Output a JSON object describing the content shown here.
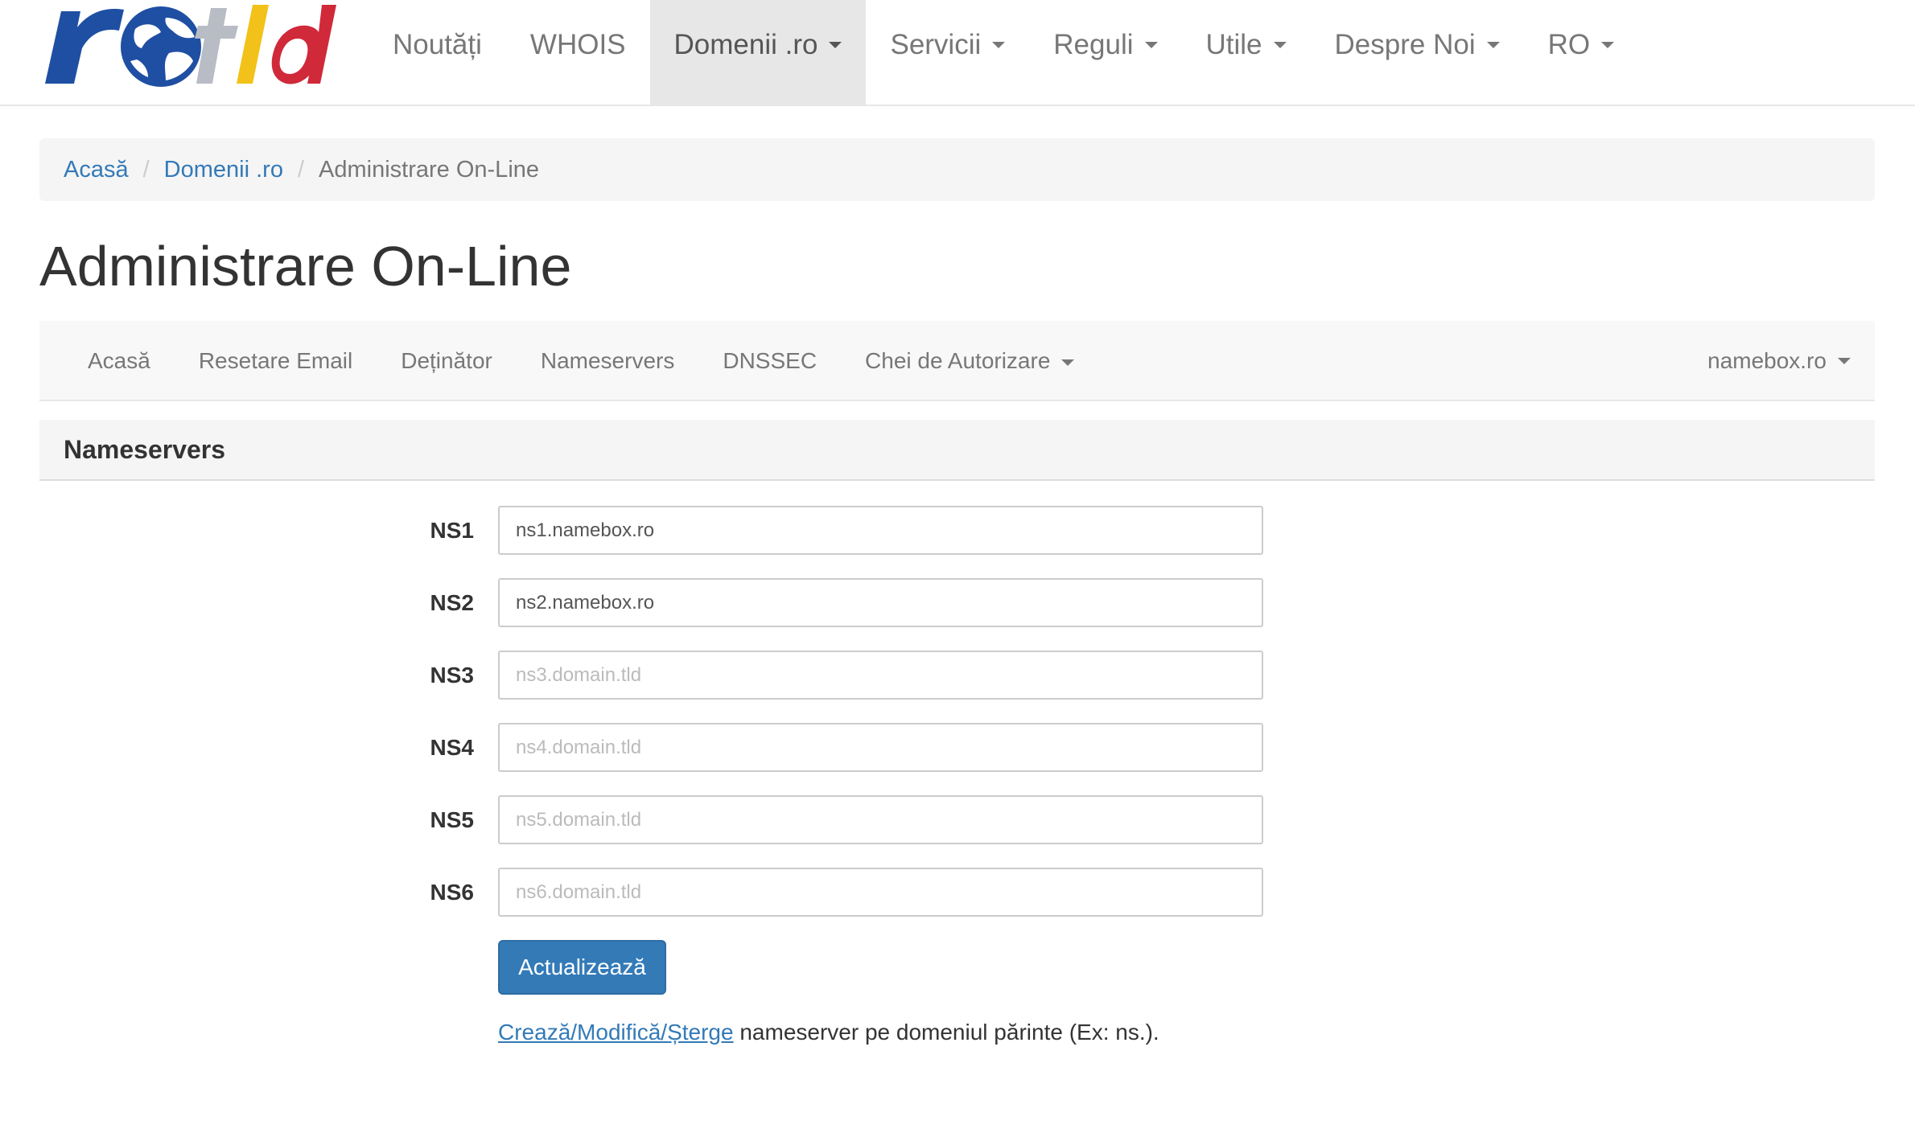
{
  "brand": {
    "logo_text": "rotld",
    "colors": {
      "blue": "#1f4fa3",
      "yellow": "#f2c21a",
      "red": "#d0293a",
      "grey": "#b8bcc4"
    }
  },
  "nav": {
    "items": [
      {
        "label": "Noutăți",
        "dropdown": false
      },
      {
        "label": "WHOIS",
        "dropdown": false
      },
      {
        "label": "Domenii .ro",
        "dropdown": true,
        "active": true
      },
      {
        "label": "Servicii",
        "dropdown": true
      },
      {
        "label": "Reguli",
        "dropdown": true
      },
      {
        "label": "Utile",
        "dropdown": true
      },
      {
        "label": "Despre Noi",
        "dropdown": true
      },
      {
        "label": "RO",
        "dropdown": true
      }
    ]
  },
  "breadcrumb": {
    "home": "Acasă",
    "section": "Domenii .ro",
    "current": "Administrare On-Line",
    "separator": "/"
  },
  "page": {
    "title": "Administrare On-Line"
  },
  "subnav": {
    "items": [
      "Acasă",
      "Resetare Email",
      "Deținător",
      "Nameservers",
      "DNSSEC"
    ],
    "dropdown_label": "Chei de Autorizare",
    "domain_selector": "namebox.ro"
  },
  "panel": {
    "title": "Nameservers"
  },
  "form": {
    "fields": [
      {
        "label": "NS1",
        "value": "ns1.namebox.ro",
        "placeholder": ""
      },
      {
        "label": "NS2",
        "value": "ns2.namebox.ro",
        "placeholder": ""
      },
      {
        "label": "NS3",
        "value": "",
        "placeholder": "ns3.domain.tld"
      },
      {
        "label": "NS4",
        "value": "",
        "placeholder": "ns4.domain.tld"
      },
      {
        "label": "NS5",
        "value": "",
        "placeholder": "ns5.domain.tld"
      },
      {
        "label": "NS6",
        "value": "",
        "placeholder": "ns6.domain.tld"
      }
    ],
    "submit_label": "Actualizează",
    "help_link": "Crează/Modifică/Șterge",
    "help_text": " nameserver pe domeniul părinte (Ex: ns.)."
  }
}
